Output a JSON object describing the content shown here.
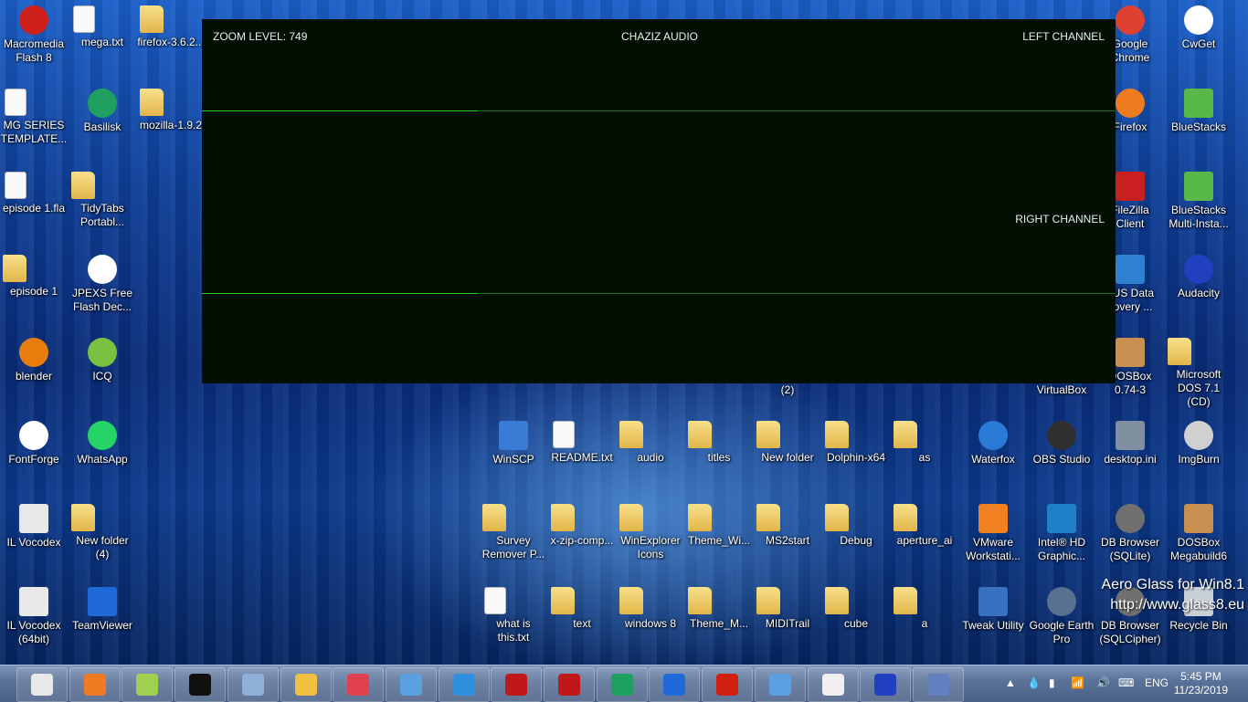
{
  "player": {
    "zoom_label": "ZOOM LEVEL: 749",
    "title": "CHAZIZ AUDIO",
    "left_label": "LEFT CHANNEL",
    "right_label": "RIGHT CHANNEL",
    "wave_color": "#2fcc2f",
    "background": "#040f04"
  },
  "icons": [
    {
      "label": "Macromedia Flash 8",
      "icon": "flash-icon",
      "color": "#d0201a",
      "shape": "round"
    },
    {
      "label": "mega.txt",
      "icon": "text-file-icon",
      "color": "#fafafa",
      "shape": "doc"
    },
    {
      "label": "firefox-3.6.2...",
      "icon": "text-file-icon",
      "color": "#f0d060",
      "shape": "folder"
    },
    {
      "label": "Google Chrome",
      "icon": "chrome-icon",
      "color": "#e04030",
      "shape": "round"
    },
    {
      "label": "CwGet",
      "icon": "cwget-icon",
      "color": "#ffffff",
      "shape": "round"
    },
    {
      "label": "MG SERIES TEMPLATE...",
      "icon": "flash-file-icon",
      "color": "#fafafa",
      "shape": "doc"
    },
    {
      "label": "Basilisk",
      "icon": "basilisk-icon",
      "color": "#1fa060",
      "shape": "round"
    },
    {
      "label": "mozilla-1.9.2",
      "icon": "folder-icon",
      "color": "#f0d060",
      "shape": "folder"
    },
    {
      "label": "Firefox",
      "icon": "firefox-icon",
      "color": "#f07a20",
      "shape": "round"
    },
    {
      "label": "BlueStacks",
      "icon": "bluestacks-icon",
      "color": "#58b848",
      "shape": "square"
    },
    {
      "label": "episode 1.fla",
      "icon": "flash-file-icon",
      "color": "#fafafa",
      "shape": "doc"
    },
    {
      "label": "TidyTabs Portabl...",
      "icon": "folder-icon",
      "color": "#f0d060",
      "shape": "folder"
    },
    {
      "label": "FileZilla Client",
      "icon": "filezilla-icon",
      "color": "#c82020",
      "shape": "square"
    },
    {
      "label": "BlueStacks Multi-Insta...",
      "icon": "bluestacks-icon",
      "color": "#58b848",
      "shape": "square"
    },
    {
      "label": "episode 1",
      "icon": "folder-icon",
      "color": "#f0d060",
      "shape": "folder"
    },
    {
      "label": "JPEXS Free Flash Dec...",
      "icon": "jpexs-icon",
      "color": "#ffffff",
      "shape": "round"
    },
    {
      "label": "eUS Data covery ...",
      "icon": "data-recovery-icon",
      "color": "#2f80d0",
      "shape": "square"
    },
    {
      "label": "Audacity",
      "icon": "audacity-icon",
      "color": "#2040c0",
      "shape": "round"
    },
    {
      "label": "blender",
      "icon": "blender-icon",
      "color": "#e87d0d",
      "shape": "round"
    },
    {
      "label": "ICQ",
      "icon": "icq-icon",
      "color": "#7ac142",
      "shape": "round"
    },
    {
      "label": "DOSBox 0.74-3",
      "icon": "dosbox-icon",
      "color": "#c89050",
      "shape": "square"
    },
    {
      "label": "Microsoft DOS 7.1 (CD)",
      "icon": "folder-icon",
      "color": "#f0d060",
      "shape": "folder"
    },
    {
      "label": "(2)",
      "icon": "folder-icon",
      "color": "#f0d060",
      "shape": "none"
    },
    {
      "label": "VirtualBox",
      "icon": "virtualbox-icon",
      "color": "#1f5fa8",
      "shape": "none"
    },
    {
      "label": "FontForge",
      "icon": "fontforge-icon",
      "color": "#ffffff",
      "shape": "round"
    },
    {
      "label": "WhatsApp",
      "icon": "whatsapp-icon",
      "color": "#25d366",
      "shape": "round"
    },
    {
      "label": "WinSCP",
      "icon": "winscp-icon",
      "color": "#3a7bd5",
      "shape": "square"
    },
    {
      "label": "README.txt",
      "icon": "text-file-icon",
      "color": "#fafafa",
      "shape": "doc"
    },
    {
      "label": "audio",
      "icon": "folder-icon",
      "color": "#f0d060",
      "shape": "folder"
    },
    {
      "label": "titles",
      "icon": "folder-icon",
      "color": "#f0d060",
      "shape": "folder"
    },
    {
      "label": "New folder",
      "icon": "folder-icon",
      "color": "#f0d060",
      "shape": "folder"
    },
    {
      "label": "Dolphin-x64",
      "icon": "folder-icon",
      "color": "#f0d060",
      "shape": "folder"
    },
    {
      "label": "as",
      "icon": "folder-icon",
      "color": "#f0d060",
      "shape": "folder"
    },
    {
      "label": "Waterfox",
      "icon": "waterfox-icon",
      "color": "#2a7ad8",
      "shape": "round"
    },
    {
      "label": "OBS Studio",
      "icon": "obs-icon",
      "color": "#303030",
      "shape": "round"
    },
    {
      "label": "desktop.ini",
      "icon": "settings-file-icon",
      "color": "#8090a0",
      "shape": "square"
    },
    {
      "label": "ImgBurn",
      "icon": "imgburn-icon",
      "color": "#d0d0d0",
      "shape": "round"
    },
    {
      "label": "IL Vocodex",
      "icon": "vocodex-icon",
      "color": "#e8e8e8",
      "shape": "square"
    },
    {
      "label": "New folder (4)",
      "icon": "folder-icon",
      "color": "#f0d060",
      "shape": "folder"
    },
    {
      "label": "Survey Remover P...",
      "icon": "survey-remover-icon",
      "color": "#f0d060",
      "shape": "folder"
    },
    {
      "label": "x-zip-comp...",
      "icon": "folder-icon",
      "color": "#f0d060",
      "shape": "folder"
    },
    {
      "label": "WinExplorer Icons",
      "icon": "folder-icon",
      "color": "#f0d060",
      "shape": "folder"
    },
    {
      "label": "Theme_Wi...",
      "icon": "folder-icon",
      "color": "#f0d060",
      "shape": "folder"
    },
    {
      "label": "MS2start",
      "icon": "folder-icon",
      "color": "#f0d060",
      "shape": "folder"
    },
    {
      "label": "Debug",
      "icon": "folder-icon",
      "color": "#f0d060",
      "shape": "folder"
    },
    {
      "label": "aperture_ai",
      "icon": "folder-icon",
      "color": "#f0d060",
      "shape": "folder"
    },
    {
      "label": "VMware Workstati...",
      "icon": "vmware-icon",
      "color": "#f08020",
      "shape": "square"
    },
    {
      "label": "Intel® HD Graphic...",
      "icon": "intel-icon",
      "color": "#1f80c8",
      "shape": "square"
    },
    {
      "label": "DB Browser (SQLite)",
      "icon": "db-browser-icon",
      "color": "#707070",
      "shape": "round"
    },
    {
      "label": "DOSBox Megabuild6",
      "icon": "dosbox-icon",
      "color": "#c89050",
      "shape": "square"
    },
    {
      "label": "IL Vocodex (64bit)",
      "icon": "vocodex-icon",
      "color": "#e8e8e8",
      "shape": "square"
    },
    {
      "label": "TeamViewer",
      "icon": "teamviewer-icon",
      "color": "#1f6ad8",
      "shape": "square"
    },
    {
      "label": "what is this.txt",
      "icon": "text-file-icon",
      "color": "#fafafa",
      "shape": "doc"
    },
    {
      "label": "text",
      "icon": "folder-icon",
      "color": "#f0d060",
      "shape": "folder"
    },
    {
      "label": "windows 8",
      "icon": "folder-icon",
      "color": "#f0d060",
      "shape": "folder"
    },
    {
      "label": "Theme_M...",
      "icon": "folder-icon",
      "color": "#f0d060",
      "shape": "folder"
    },
    {
      "label": "MIDITrail",
      "icon": "folder-icon",
      "color": "#f0d060",
      "shape": "folder"
    },
    {
      "label": "cube",
      "icon": "folder-icon",
      "color": "#f0d060",
      "shape": "folder"
    },
    {
      "label": "a",
      "icon": "folder-icon",
      "color": "#f0d060",
      "shape": "folder"
    },
    {
      "label": "Tweak Utility",
      "icon": "tweak-utility-icon",
      "color": "#3a70c0",
      "shape": "square"
    },
    {
      "label": "Google Earth Pro",
      "icon": "google-earth-icon",
      "color": "#5a7090",
      "shape": "round"
    },
    {
      "label": "DB Browser (SQLCipher)",
      "icon": "db-browser-icon",
      "color": "#707070",
      "shape": "round"
    },
    {
      "label": "Recycle Bin",
      "icon": "recycle-bin-icon",
      "color": "#c8d0d8",
      "shape": "square"
    }
  ],
  "watermark": {
    "line1": "Aero Glass for Win8.1",
    "line2": "http://www.glass8.eu"
  },
  "taskbar": {
    "buttons": [
      {
        "icon": "snipping-tool-icon",
        "color": "#e8e8e8"
      },
      {
        "icon": "firefox-icon",
        "color": "#f07a20"
      },
      {
        "icon": "notepad-plus-icon",
        "color": "#a0d050"
      },
      {
        "icon": "command-prompt-icon",
        "color": "#101010"
      },
      {
        "icon": "system-monitor-icon",
        "color": "#90b0d8"
      },
      {
        "icon": "file-explorer-icon",
        "color": "#f0c040"
      },
      {
        "icon": "app-launcher-icon",
        "color": "#e04050"
      },
      {
        "icon": "notepad-icon",
        "color": "#5aa0e0"
      },
      {
        "icon": "users-icon",
        "color": "#3090e0"
      },
      {
        "icon": "flash-icon",
        "color": "#c01818"
      },
      {
        "icon": "flash-icon",
        "color": "#c01818"
      },
      {
        "icon": "basilisk-icon",
        "color": "#1fa060"
      },
      {
        "icon": "teamviewer-icon",
        "color": "#1f6ad8"
      },
      {
        "icon": "flash-player-icon",
        "color": "#d02010"
      },
      {
        "icon": "notepad-icon",
        "color": "#5aa0e0"
      },
      {
        "icon": "7zip-icon",
        "color": "#f0f0f0"
      },
      {
        "icon": "audacity-icon",
        "color": "#2040c0"
      },
      {
        "icon": "control-panel-icon",
        "color": "#6080c0"
      }
    ],
    "tray": {
      "language": "ENG",
      "time": "5:45 PM",
      "date": "11/23/2019"
    }
  }
}
